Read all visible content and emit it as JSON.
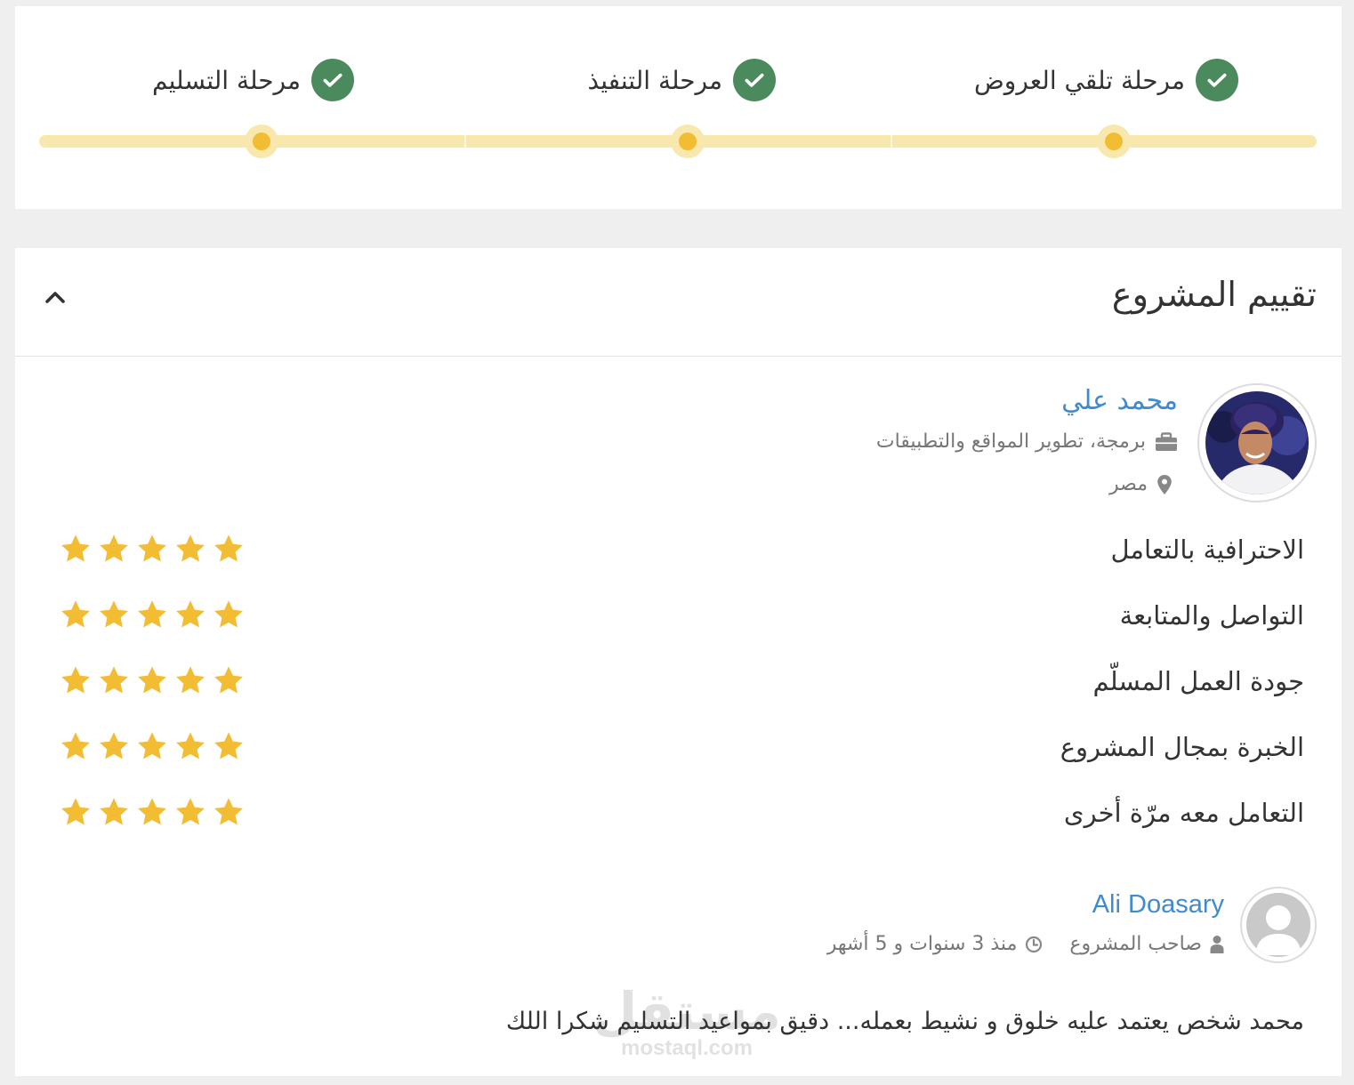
{
  "stages": [
    {
      "label": "مرحلة تلقي العروض",
      "status": "done"
    },
    {
      "label": "مرحلة التنفيذ",
      "status": "done"
    },
    {
      "label": "مرحلة التسليم",
      "status": "done"
    }
  ],
  "review": {
    "title": "تقييم المشروع",
    "collapse_icon": "chevron-up-icon",
    "freelancer": {
      "name": "محمد علي",
      "specialty": "برمجة، تطوير المواقع والتطبيقات",
      "location": "مصر"
    },
    "ratings": [
      {
        "label": "الاحترافية بالتعامل",
        "stars": 5
      },
      {
        "label": "التواصل والمتابعة",
        "stars": 5
      },
      {
        "label": "جودة العمل المسلّم",
        "stars": 5
      },
      {
        "label": "الخبرة بمجال المشروع",
        "stars": 5
      },
      {
        "label": "التعامل معه مرّة أخرى",
        "stars": 5
      }
    ],
    "owner": {
      "name": "Ali Doasary",
      "role": "صاحب المشروع",
      "time": "منذ 3 سنوات و 5 أشهر"
    },
    "comment": "محمد شخص يعتمد عليه خلوق و نشيط بعمله... دقيق بمواعيد التسليم شكرا اللك",
    "watermark": {
      "ar": "مستقل",
      "en": "mostaql.com"
    }
  },
  "colors": {
    "check_green": "#4a8a5c",
    "track_yellow": "#f8e8ad",
    "dot_yellow": "#f3bd33",
    "star_yellow": "#f3bd33",
    "link_blue": "#3f8ad0"
  }
}
